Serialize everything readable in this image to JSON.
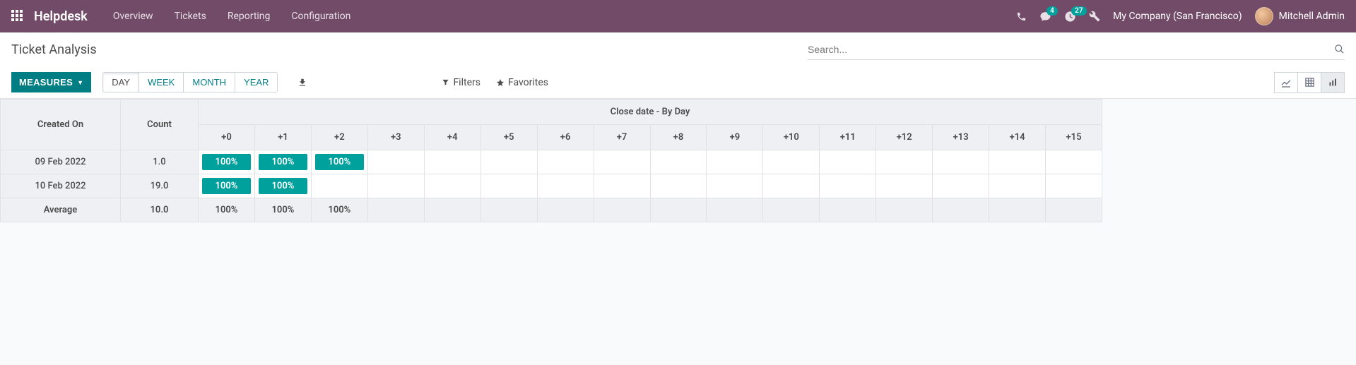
{
  "nav": {
    "brand": "Helpdesk",
    "menu": [
      "Overview",
      "Tickets",
      "Reporting",
      "Configuration"
    ],
    "msg_badge": "4",
    "activity_badge": "27",
    "company": "My Company (San Francisco)",
    "user": "Mitchell Admin"
  },
  "cp": {
    "title": "Ticket Analysis",
    "search_placeholder": "Search...",
    "measures": "MEASURES",
    "scales": [
      "DAY",
      "WEEK",
      "MONTH",
      "YEAR"
    ],
    "active_scale": "DAY",
    "filters_label": "Filters",
    "favorites_label": "Favorites"
  },
  "table": {
    "col_created": "Created On",
    "col_count": "Count",
    "group_header": "Close date - By Day",
    "day_headers": [
      "+0",
      "+1",
      "+2",
      "+3",
      "+4",
      "+5",
      "+6",
      "+7",
      "+8",
      "+9",
      "+10",
      "+11",
      "+12",
      "+13",
      "+14",
      "+15"
    ],
    "rows": [
      {
        "created": "09 Feb 2022",
        "count": "1.0",
        "cells": [
          "100%",
          "100%",
          "100%",
          "",
          "",
          "",
          "",
          "",
          "",
          "",
          "",
          "",
          "",
          "",
          "",
          ""
        ]
      },
      {
        "created": "10 Feb 2022",
        "count": "19.0",
        "cells": [
          "100%",
          "100%",
          "",
          "",
          "",
          "",
          "",
          "",
          "",
          "",
          "",
          "",
          "",
          "",
          "",
          ""
        ]
      }
    ],
    "avg_label": "Average",
    "avg_count": "10.0",
    "avg_cells": [
      "100%",
      "100%",
      "100%",
      "",
      "",
      "",
      "",
      "",
      "",
      "",
      "",
      "",
      "",
      "",
      "",
      ""
    ]
  },
  "chart_data": {
    "type": "table",
    "title": "Ticket Analysis",
    "group_by": "Close date - By Day",
    "row_dimension": "Created On",
    "measure": "Count",
    "columns": [
      "+0",
      "+1",
      "+2",
      "+3",
      "+4",
      "+5",
      "+6",
      "+7",
      "+8",
      "+9",
      "+10",
      "+11",
      "+12",
      "+13",
      "+14",
      "+15"
    ],
    "rows": [
      {
        "created_on": "09 Feb 2022",
        "count": 1.0,
        "values": [
          100,
          100,
          100,
          null,
          null,
          null,
          null,
          null,
          null,
          null,
          null,
          null,
          null,
          null,
          null,
          null
        ]
      },
      {
        "created_on": "10 Feb 2022",
        "count": 19.0,
        "values": [
          100,
          100,
          null,
          null,
          null,
          null,
          null,
          null,
          null,
          null,
          null,
          null,
          null,
          null,
          null,
          null
        ]
      }
    ],
    "average": {
      "count": 10.0,
      "values": [
        100,
        100,
        100,
        null,
        null,
        null,
        null,
        null,
        null,
        null,
        null,
        null,
        null,
        null,
        null,
        null
      ]
    },
    "unit": "%"
  }
}
